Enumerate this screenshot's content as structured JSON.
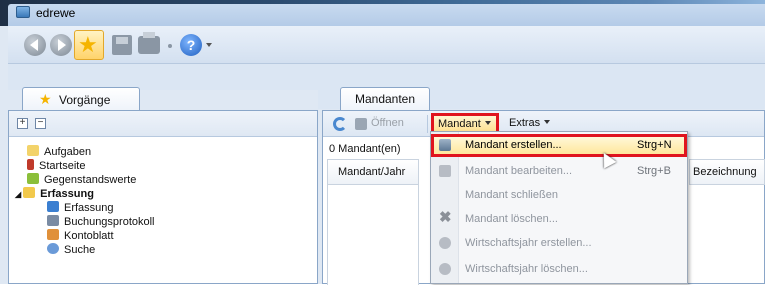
{
  "window": {
    "title": "edrewe"
  },
  "toolbar": {
    "back_icon": "back-arrow-icon",
    "forward_icon": "forward-arrow-icon",
    "favorites_icon": "star-icon",
    "save_icon": "save-icon",
    "print_icon": "print-icon",
    "help_icon": "help-icon",
    "help_glyph": "?"
  },
  "left": {
    "tab_label": "Vorgänge",
    "expand_glyph": "+",
    "collapse_glyph": "−",
    "tree": [
      {
        "label": "Aufgaben",
        "color": "#f3d36a"
      },
      {
        "label": "Startseite",
        "color": "#c03a2b"
      },
      {
        "label": "Gegenstandswerte",
        "color": "#8bbf3a"
      },
      {
        "label": "Erfassung",
        "color": "#f2c94c",
        "bold": true,
        "expanded": true
      },
      {
        "label": "Erfassung",
        "color": "#3b7fd1"
      },
      {
        "label": "Buchungsprotokoll",
        "color": "#7a8ba3"
      },
      {
        "label": "Kontoblatt",
        "color": "#e0903a"
      },
      {
        "label": "Suche",
        "color": "#6a9ad8"
      }
    ]
  },
  "right": {
    "tab_label": "Mandanten",
    "toolbar": {
      "refresh_icon": "refresh-icon",
      "open_label": "Öffnen",
      "menu_mandant": "Mandant",
      "menu_extras": "Extras"
    },
    "count_text": "0 Mandant(en)",
    "columns": [
      "Mandant/Jahr",
      "Bezeichnung"
    ]
  },
  "dropdown": {
    "items": [
      {
        "label": "Mandant erstellen...",
        "shortcut": "Strg+N",
        "active": true,
        "icon": "create-client-icon"
      },
      {
        "label": "Mandant bearbeiten...",
        "shortcut": "Strg+B",
        "active": false,
        "icon": "edit-client-icon"
      },
      {
        "label": "Mandant schließen",
        "shortcut": "",
        "active": false,
        "icon": ""
      },
      {
        "label": "Mandant löschen...",
        "shortcut": "",
        "active": false,
        "icon": "delete-x-icon"
      },
      {
        "label": "Wirtschaftsjahr erstellen...",
        "shortcut": "",
        "active": false,
        "icon": "create-year-icon"
      },
      {
        "label": "Wirtschaftsjahr löschen...",
        "shortcut": "",
        "active": false,
        "icon": "delete-year-icon"
      }
    ]
  },
  "colors": {
    "highlight_border": "#e0141e",
    "accent": "#4a88cf"
  }
}
